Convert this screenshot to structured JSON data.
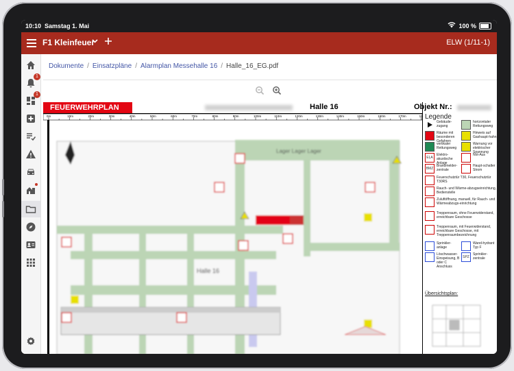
{
  "status": {
    "time": "10:10",
    "date": "Samstag 1. Mai",
    "battery": "100 %"
  },
  "appbar": {
    "title": "F1 Kleinfeuer",
    "right": "ELW (1/11-1)"
  },
  "sidebar": {
    "badge_notifications": "1",
    "badge_tasks": "1"
  },
  "breadcrumb": [
    "Dokumente",
    "Einsatzpläne",
    "Alarmplan Messehalle 16",
    "Halle_16_EG.pdf"
  ],
  "plan": {
    "header_label": "FEUERWEHRPLAN",
    "hall": "Halle 16",
    "object_label": "Objekt Nr.:",
    "ruler": [
      "0m",
      "10m",
      "20m",
      "30m",
      "40m",
      "50m",
      "60m",
      "70m",
      "80m",
      "90m",
      "100m",
      "110m",
      "120m",
      "130m",
      "140m",
      "150m",
      "160m",
      "170m",
      "180m"
    ],
    "hall_label": "Halle 16",
    "legend_title": "Legende",
    "legend": [
      {
        "t": "Gebäude-zugang"
      },
      {
        "t": "horizontaler Rettungsweg"
      },
      {
        "t": "Räume mit besonderen Gefahren"
      },
      {
        "t": "Hinweis auf Gashaupt-hahn"
      },
      {
        "t": "vertikaler Rettungsweg"
      },
      {
        "t": "Warnung vor elektrischer Spannung"
      },
      {
        "t": "Elektro-akustische Anlage",
        "s": "ELA"
      },
      {
        "t": "Not-Aus"
      },
      {
        "t": "Brandmelder-zentrale",
        "s": "BMZ"
      },
      {
        "t": "Haupt-schalter Strom"
      },
      {
        "t": "Feuerschutztür T30, Feuerschutztür T30RS"
      },
      {
        "t": "Rauch- und Wärme-abzugseinrichtung, Bedienstelle"
      },
      {
        "t": "Zuluftöffnung, manuell, für Rauch- und Wärmeabzugs-einrichtung"
      },
      {
        "t": "Treppenraum, ohne Feuerwiderstand, erreichbare Geschosse"
      },
      {
        "t": "Treppenraum, mit Feuerwiderstand, erreichbare Geschosse, mit Treppenraumbezeichnung"
      },
      {
        "t": "Sprinkler-anlage"
      },
      {
        "t": "Wand-hydrant Typ F"
      },
      {
        "t": "Löschwasser-Einspeisung, B oder C Anschluss"
      },
      {
        "t": "Sprinkler-zentrale",
        "s": "SPZ"
      }
    ],
    "overview": "Übersichtsplan:"
  },
  "colors": {
    "brand": "#a72b1e",
    "fwp_red": "#e30613",
    "route_green": "#9ec59a",
    "link": "#4356a6"
  }
}
